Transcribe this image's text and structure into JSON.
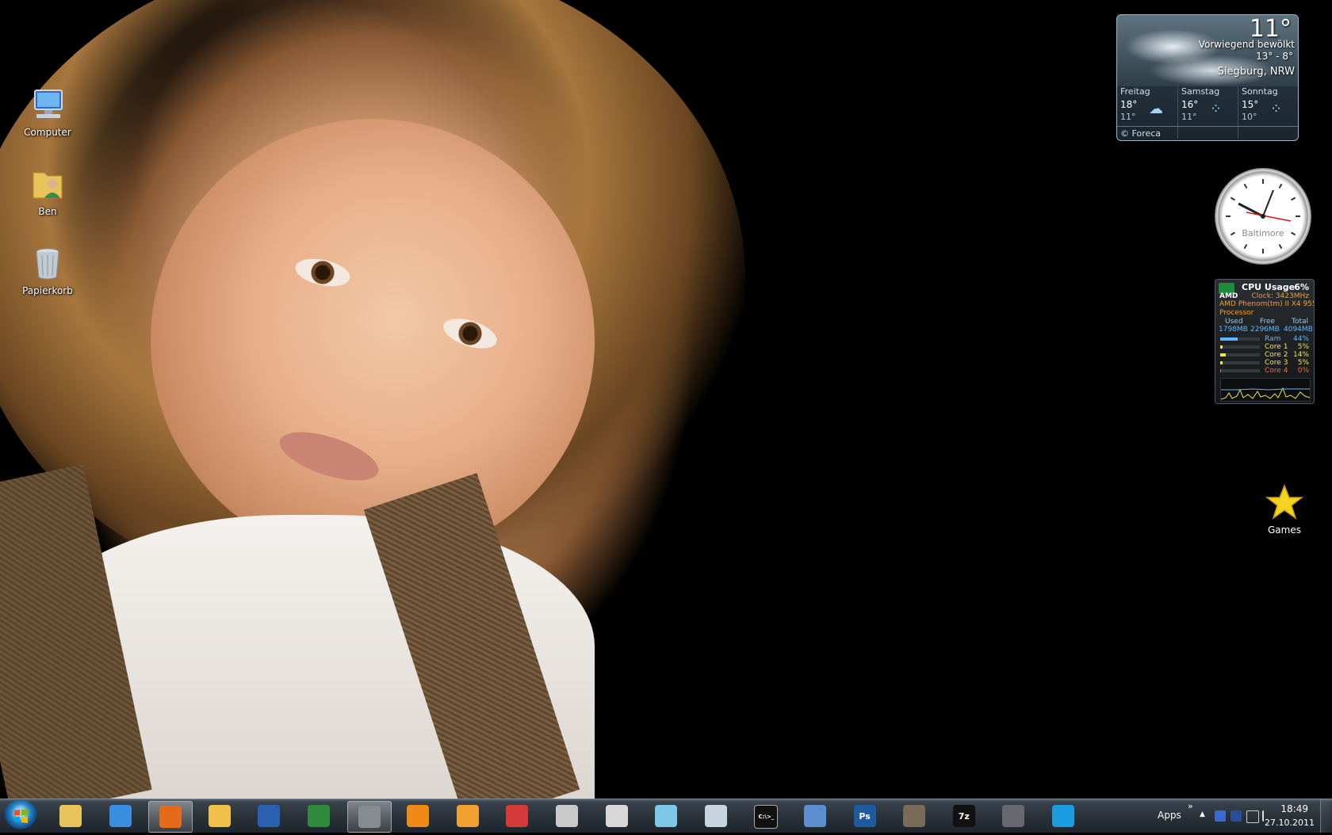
{
  "desktop": {
    "icons": [
      {
        "label": "Computer",
        "icon": "computer-icon"
      },
      {
        "label": "Ben",
        "icon": "user-folder-icon"
      },
      {
        "label": "Papierkorb",
        "icon": "recycle-bin-icon"
      },
      {
        "label": "Games",
        "icon": "star-icon"
      }
    ]
  },
  "weather": {
    "temp": "11°",
    "condition": "Vorwiegend bewölkt",
    "range": "13° - 8°",
    "location": "Siegburg, NRW",
    "forecast": [
      {
        "day": "Freitag",
        "high": "18°",
        "low": "11°",
        "icon": "cloudy-icon"
      },
      {
        "day": "Samstag",
        "high": "16°",
        "low": "11°",
        "icon": "rain-icon"
      },
      {
        "day": "Sonntag",
        "high": "15°",
        "low": "10°",
        "icon": "rain-icon"
      }
    ],
    "credit": "© Foreca"
  },
  "clock": {
    "city": "Baltimore"
  },
  "cpu": {
    "title": "CPU Usage",
    "usage": "6%",
    "brand": "AMD",
    "clock": "Clock: 3423MHz",
    "model": "AMD Phenom(tm) II X4 955",
    "model2": "Processor",
    "headers": {
      "used": "Used",
      "free": "Free",
      "total": "Total"
    },
    "memory": {
      "used": "1798MB",
      "free": "2296MB",
      "total": "4094MB"
    },
    "bars": [
      {
        "label": "Ram",
        "value": "44%",
        "fraction": 0.44,
        "color": "#5fb7ff"
      },
      {
        "label": "Core 1",
        "value": "5%",
        "fraction": 0.05,
        "color": "#f3e24a"
      },
      {
        "label": "Core 2",
        "value": "14%",
        "fraction": 0.14,
        "color": "#f3e24a"
      },
      {
        "label": "Core 3",
        "value": "5%",
        "fraction": 0.05,
        "color": "#f3e24a"
      },
      {
        "label": "Core 4",
        "value": "0%",
        "fraction": 0.0,
        "color": "#f06a3a"
      }
    ]
  },
  "taskbar": {
    "start_icon": "windows-start-icon",
    "items": [
      {
        "name": "explorer",
        "icon": "folder-icon",
        "color": "#e8c25a",
        "active": false
      },
      {
        "name": "internet-explorer",
        "icon": "ie-icon",
        "color": "#3a8ee0",
        "active": false
      },
      {
        "name": "firefox",
        "icon": "firefox-icon",
        "color": "#e46a1c",
        "active": true
      },
      {
        "name": "outlook",
        "icon": "mail-icon",
        "color": "#f0c04a",
        "active": false
      },
      {
        "name": "word",
        "icon": "word-icon",
        "color": "#2b5fb0",
        "active": false
      },
      {
        "name": "excel",
        "icon": "excel-icon",
        "color": "#2f8a3c",
        "active": false
      },
      {
        "name": "security",
        "icon": "lock-icon",
        "color": "#888c90",
        "active": true
      },
      {
        "name": "vlc",
        "icon": "vlc-icon",
        "color": "#f08a16",
        "active": false
      },
      {
        "name": "media-player",
        "icon": "play-icon",
        "color": "#f0a030",
        "active": false
      },
      {
        "name": "save",
        "icon": "floppy-icon",
        "color": "#d33a3a",
        "active": false
      },
      {
        "name": "disc-burner",
        "icon": "disc-icon",
        "color": "#c9c9c9",
        "active": false
      },
      {
        "name": "todo",
        "icon": "checkmark-icon",
        "color": "#d8d8d8",
        "active": false
      },
      {
        "name": "notes",
        "icon": "pen-icon",
        "color": "#7cc8e6",
        "active": false
      },
      {
        "name": "calculator",
        "icon": "calculator-icon",
        "color": "#c7d4e0",
        "active": false
      },
      {
        "name": "command-prompt",
        "icon": "terminal-icon",
        "color": "#111111",
        "active": false
      },
      {
        "name": "virtualbox",
        "icon": "cube-icon",
        "color": "#5d8fd0",
        "active": false
      },
      {
        "name": "photoshop",
        "icon": "photoshop-icon",
        "color": "#1f5a9e",
        "active": false
      },
      {
        "name": "photo-viewer",
        "icon": "photo-icon",
        "color": "#7a6a58",
        "active": false
      },
      {
        "name": "7zip",
        "icon": "archive-icon",
        "color": "#111111",
        "active": false
      },
      {
        "name": "steam",
        "icon": "steam-icon",
        "color": "#666a70",
        "active": false
      },
      {
        "name": "skype",
        "icon": "skype-icon",
        "color": "#1a9de0",
        "active": false
      }
    ],
    "photoshop_label": "Ps",
    "zip_label": "7z",
    "cmd_label": "C:\\>_"
  },
  "tray": {
    "toolbar": "Apps",
    "chevron": "»",
    "expand": "▲",
    "time": "18:49",
    "date": "27.10.2011"
  }
}
